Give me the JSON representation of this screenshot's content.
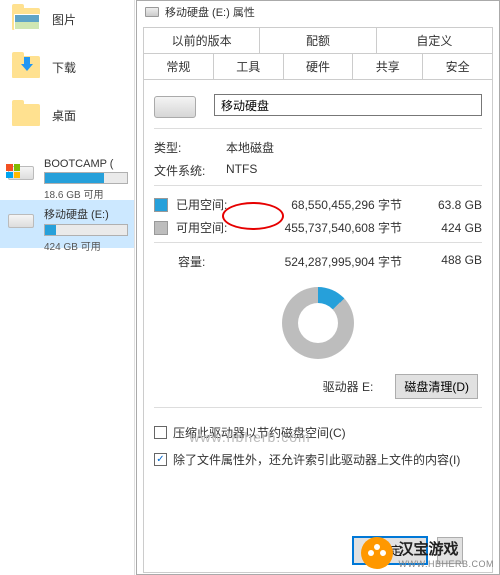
{
  "explorer": {
    "quick": [
      {
        "label": "图片",
        "icon": "pictures-folder-icon"
      },
      {
        "label": "下载",
        "icon": "downloads-folder-icon"
      },
      {
        "label": "桌面",
        "icon": "desktop-folder-icon"
      }
    ],
    "drives": [
      {
        "name": "BOOTCAMP (",
        "free_text": "18.6 GB 可用",
        "fill_pct": 72,
        "selected": false,
        "has_winlogo": true
      },
      {
        "name": "移动硬盘 (E:)",
        "free_text": "424 GB 可用",
        "fill_pct": 13,
        "selected": true,
        "has_winlogo": false
      }
    ]
  },
  "dialog": {
    "title": "移动硬盘 (E:) 属性",
    "tabs_top": [
      "以前的版本",
      "配额",
      "自定义"
    ],
    "tabs_bottom": [
      "常规",
      "工具",
      "硬件",
      "共享",
      "安全"
    ],
    "active_tab": "常规",
    "name_value": "移动硬盘",
    "type_label": "类型:",
    "type_value": "本地磁盘",
    "fs_label": "文件系统:",
    "fs_value": "NTFS",
    "used_label": "已用空间:",
    "used_bytes": "68,550,455,296 字节",
    "used_h": "63.8 GB",
    "free_label": "可用空间:",
    "free_bytes": "455,737,540,608 字节",
    "free_h": "424 GB",
    "cap_label": "容量:",
    "cap_bytes": "524,287,995,904 字节",
    "cap_h": "488 GB",
    "drive_letter": "驱动器 E:",
    "cleanup_btn": "磁盘清理(D)",
    "check_compress": "压缩此驱动器以节约磁盘空间(C)",
    "check_index": "除了文件属性外，还允许索引此驱动器上文件的内容(I)",
    "ok_btn": "确定"
  },
  "watermark": "www.hbherb.com",
  "brand": {
    "name": "汉宝游戏",
    "url": "WWW.HBHERB.COM"
  }
}
